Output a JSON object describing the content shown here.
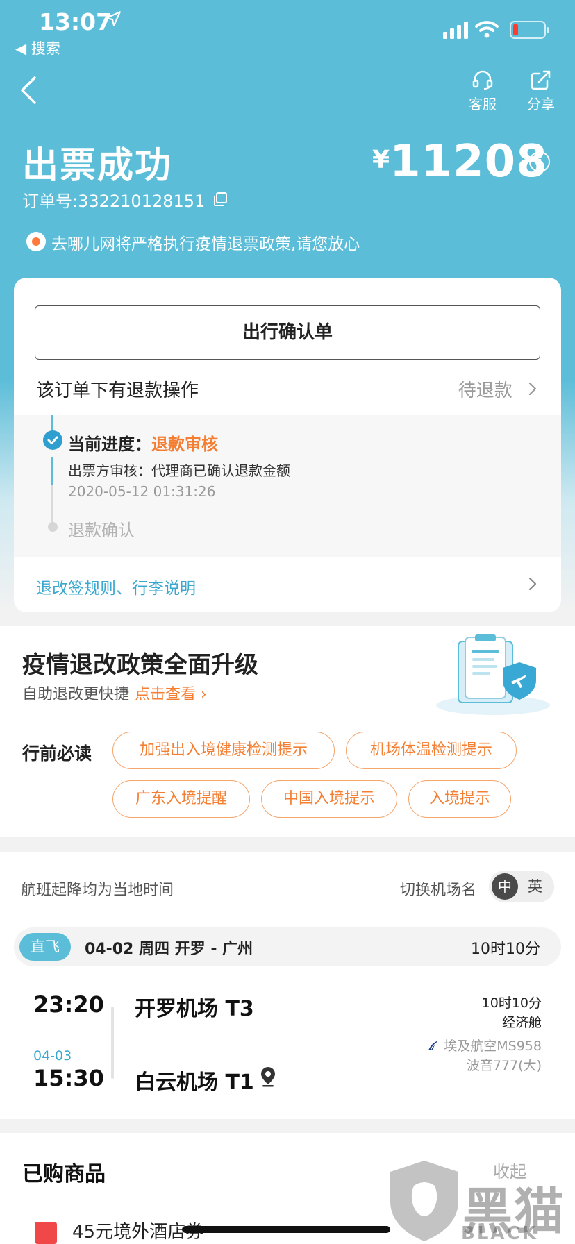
{
  "status_bar": {
    "time": "13:07",
    "back_app": "◀ 搜索"
  },
  "nav": {
    "service_label": "客服",
    "share_label": "分享"
  },
  "header": {
    "title": "出票成功",
    "order_no": "订单号:332210128151",
    "currency": "¥",
    "price": "11208",
    "notice": "去哪儿网将严格执行疫情退票政策,请您放心"
  },
  "card": {
    "confirm_button": "出行确认单",
    "refund_title": "该订单下有退款操作",
    "refund_status": "待退款",
    "progress": {
      "current_label": "当前进度：",
      "current_value": "退款审核",
      "detail": "出票方审核：代理商已确认退款金额",
      "time": "2020-05-12 01:31:26",
      "next_step": "退款确认"
    },
    "rules_link": "退改签规则、行李说明"
  },
  "policy": {
    "title": "疫情退改政策全面升级",
    "subtitle": "自助退改更快捷",
    "link": "点击查看 ›",
    "label": "行前必读",
    "tags": [
      "加强出入境健康检测提示",
      "机场体温检测提示",
      "广东入境提醒",
      "中国入境提示",
      "入境提示"
    ]
  },
  "flight": {
    "time_note": "航班起降均为当地时间",
    "switch_label": "切换机场名",
    "switch_zh": "中",
    "switch_en": "英",
    "badge": "直飞",
    "date_route": "04-02  周四   开罗 - 广州",
    "duration": "10时10分",
    "dep_time": "23:20",
    "arr_date": "04-03",
    "arr_time": "15:30",
    "dep_airport": "开罗机场 T3",
    "arr_airport": "白云机场 T1",
    "right_duration": "10时10分",
    "cabin": "经济舱",
    "airline": "埃及航空MS958",
    "aircraft": "波音777(大)"
  },
  "purchased": {
    "title": "已购商品",
    "collapse": "收起",
    "item": "45元境外酒店券"
  },
  "watermark": {
    "text": "黑猫",
    "sub": "BLACK CAT"
  },
  "colors": {
    "primary": "#5bbdd8",
    "accent": "#f47f33",
    "link": "#3ba8cf"
  }
}
